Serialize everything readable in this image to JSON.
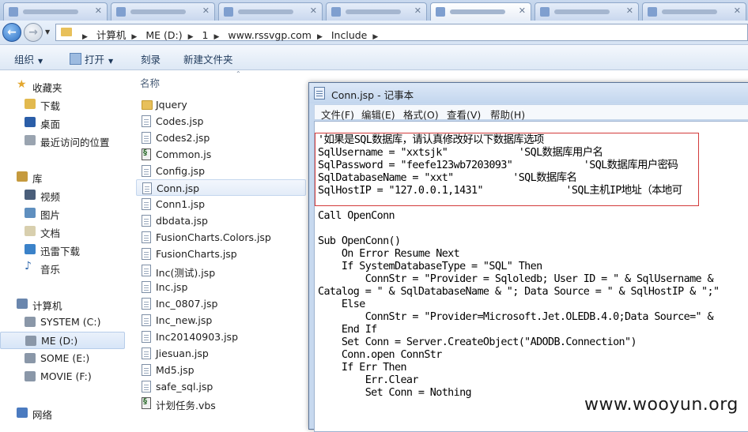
{
  "addressbar": {
    "breadcrumbs": [
      "计算机",
      "ME (D:)",
      "1",
      "www.rssvgp.com",
      "Include"
    ]
  },
  "commandbar": {
    "organize": "组织",
    "open": "打开",
    "burn": "刻录",
    "new_folder": "新建文件夹"
  },
  "navpane": {
    "favorites": "收藏夹",
    "downloads": "下载",
    "desktop": "桌面",
    "recent": "最近访问的位置",
    "libraries": "库",
    "videos": "视频",
    "pictures": "图片",
    "documents": "文档",
    "xunlei": "迅雷下载",
    "music": "音乐",
    "computer": "计算机",
    "drive_c": "SYSTEM (C:)",
    "drive_d": "ME (D:)",
    "drive_e": "SOME (E:)",
    "drive_f": "MOVIE (F:)",
    "network": "网络"
  },
  "filelist": {
    "col_name": "名称",
    "files": [
      {
        "name": "Jquery",
        "type": "folder"
      },
      {
        "name": "Codes.jsp",
        "type": "doc"
      },
      {
        "name": "Codes2.jsp",
        "type": "doc"
      },
      {
        "name": "Common.js",
        "type": "script"
      },
      {
        "name": "Config.jsp",
        "type": "doc"
      },
      {
        "name": "Conn.jsp",
        "type": "doc",
        "selected": true
      },
      {
        "name": "Conn1.jsp",
        "type": "doc"
      },
      {
        "name": "dbdata.jsp",
        "type": "doc"
      },
      {
        "name": "FusionCharts.Colors.jsp",
        "type": "doc"
      },
      {
        "name": "FusionCharts.jsp",
        "type": "doc"
      },
      {
        "name": "Inc(测试).jsp",
        "type": "doc"
      },
      {
        "name": "Inc.jsp",
        "type": "doc"
      },
      {
        "name": "Inc_0807.jsp",
        "type": "doc"
      },
      {
        "name": "Inc_new.jsp",
        "type": "doc"
      },
      {
        "name": "Inc20140903.jsp",
        "type": "doc"
      },
      {
        "name": "Jiesuan.jsp",
        "type": "doc"
      },
      {
        "name": "Md5.jsp",
        "type": "doc"
      },
      {
        "name": "safe_sql.jsp",
        "type": "doc"
      },
      {
        "name": "计划任务.vbs",
        "type": "script"
      }
    ]
  },
  "notepad": {
    "title": "Conn.jsp - 记事本",
    "menu": {
      "file": "文件(F)",
      "edit": "编辑(E)",
      "format": "格式(O)",
      "view": "查看(V)",
      "help": "帮助(H)"
    },
    "lines": [
      "'如果是SQL数据库，请认真修改好以下数据库选项",
      "SqlUsername = \"xxtsjk\"            'SQL数据库用户名",
      "SqlPassword = \"feefe123wb7203093\"            'SQL数据库用户密码",
      "SqlDatabaseName = \"xxt\"          'SQL数据库名",
      "SqlHostIP = \"127.0.0.1,1431\"              'SQL主机IP地址（本地可",
      "",
      "Call OpenConn",
      "",
      "Sub OpenConn()",
      "    On Error Resume Next",
      "    If SystemDatabaseType = \"SQL\" Then",
      "        ConnStr = \"Provider = Sqloledb; User ID = \" & SqlUsername &",
      "Catalog = \" & SqlDatabaseName & \"; Data Source = \" & SqlHostIP & \";\"",
      "    Else",
      "        ConnStr = \"Provider=Microsoft.Jet.OLEDB.4.0;Data Source=\" &",
      "    End If",
      "    Set Conn = Server.CreateObject(\"ADODB.Connection\")",
      "    Conn.open ConnStr",
      "    If Err Then",
      "        Err.Clear",
      "        Set Conn = Nothing"
    ]
  },
  "watermark": "www.wooyun.org"
}
